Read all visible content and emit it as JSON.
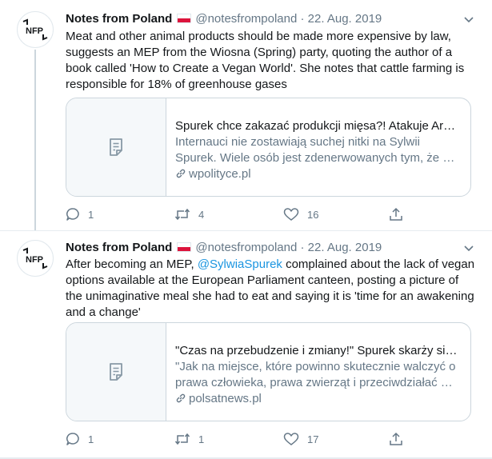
{
  "colors": {
    "link": "#1b95e0",
    "secondary": "#657786",
    "text": "#14171a",
    "border": "#ccd6dd",
    "flag_red": "#dc143c"
  },
  "tweets": [
    {
      "avatar_text": "NFP",
      "name": "Notes from Poland",
      "handle": "@notesfrompoland",
      "separator": "·",
      "date": "22. Aug. 2019",
      "text": "Meat and other animal products should be made more expensive by law, suggests an MEP from the Wiosna (Spring) party, quoting the author of a book called 'How to Create a Vegan World'. She notes that cattle farming is responsible for 18% of greenhouse gases",
      "card": {
        "title": "Spurek chce zakazać produkcji mięsa?! Atakuje Ar…",
        "description": "Internauci nie zostawiają suchej nitki na Sylwii Spurek. Wiele osób jest zdenerwowanych tym, że …",
        "domain": "wpolityce.pl"
      },
      "actions": {
        "replies": "1",
        "retweets": "4",
        "likes": "16"
      }
    },
    {
      "avatar_text": "NFP",
      "name": "Notes from Poland",
      "handle": "@notesfrompoland",
      "separator": "·",
      "date": "22. Aug. 2019",
      "text_before": "After becoming an MEP, ",
      "mention": "@SylwiaSpurek",
      "text_after": " complained about the lack of vegan options available at the European Parliament canteen, posting a picture of the unimaginative meal she had to eat and saying it is 'time for an awakening and a change'",
      "card": {
        "title": "\"Czas na przebudzenie i zmiany!\" Spurek skarży si…",
        "description": "\"Jak na miejsce, które powinno skutecznie walczyć o prawa człowieka, prawa zwierząt i przeciwdziałać …",
        "domain": "polsatnews.pl"
      },
      "actions": {
        "replies": "1",
        "retweets": "1",
        "likes": "17"
      }
    }
  ]
}
